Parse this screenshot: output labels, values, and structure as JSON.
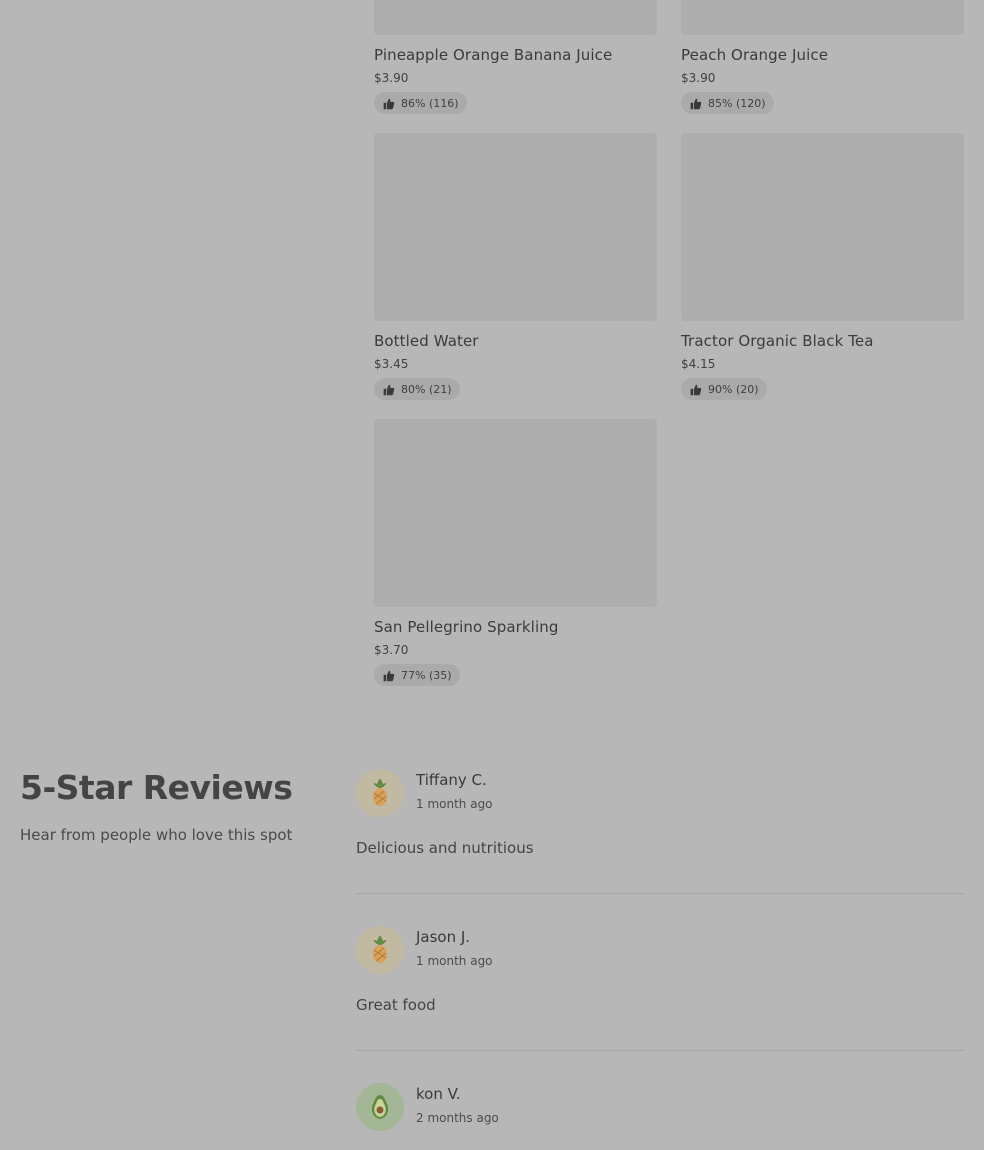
{
  "products": [
    {
      "name": "Pineapple Orange Banana Juice",
      "price": "$3.90",
      "rating": "86% (116)"
    },
    {
      "name": "Peach Orange Juice",
      "price": "$3.90",
      "rating": "85% (120)"
    },
    {
      "name": "Bottled Water",
      "price": "$3.45",
      "rating": "80% (21)"
    },
    {
      "name": "Tractor Organic Black Tea",
      "price": "$4.15",
      "rating": "90% (20)"
    },
    {
      "name": "San Pellegrino Sparkling",
      "price": "$3.70",
      "rating": "77% (35)"
    }
  ],
  "reviews_section": {
    "title": "5-Star Reviews",
    "subtitle": "Hear from people who love this spot"
  },
  "reviews": [
    {
      "name": "Tiffany C.",
      "time": "1 month ago",
      "text": "Delicious and nutritious",
      "avatar_icon": "pineapple-icon"
    },
    {
      "name": "Jason J.",
      "time": "1 month ago",
      "text": "Great food",
      "avatar_icon": "pineapple-icon"
    },
    {
      "name": "kon V.",
      "time": "2 months ago",
      "text": "",
      "avatar_icon": "avocado-icon"
    }
  ],
  "colors": {
    "overlay_bg": "#b7b7b7",
    "image_placeholder": "#adadad",
    "rating_pill": "#aaaaaa"
  }
}
